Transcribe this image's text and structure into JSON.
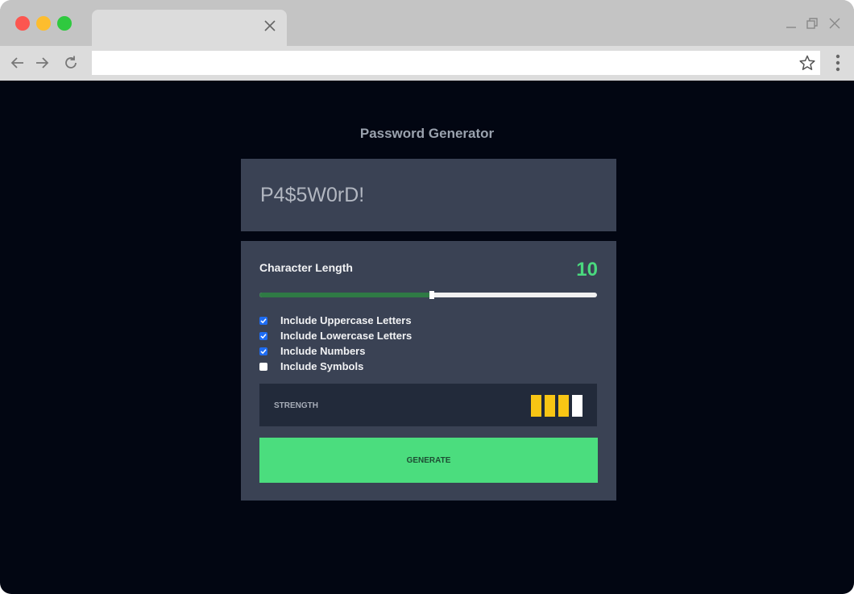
{
  "browser": {
    "tab_title": "",
    "address_value": ""
  },
  "page": {
    "title": "Password Generator",
    "result": "P4$5W0rD!",
    "length_label": "Character Length",
    "length_value": "10",
    "length_fraction": 0.51,
    "options": [
      {
        "label": "Include Uppercase Letters",
        "checked": true
      },
      {
        "label": "Include Lowercase Letters",
        "checked": true
      },
      {
        "label": "Include Numbers",
        "checked": true
      },
      {
        "label": "Include Symbols",
        "checked": false
      }
    ],
    "strength_label": "STRENGTH",
    "strength_level": 3,
    "strength_max": 4,
    "generate_label": "GENERATE"
  },
  "colors": {
    "accent": "#4bdd7e",
    "strength": "#f8c514",
    "panel": "#3a4254",
    "background": "#020612"
  },
  "icons": [
    "close-icon",
    "minimize-icon",
    "restore-icon",
    "back-arrow-icon",
    "forward-arrow-icon",
    "reload-icon",
    "star-icon",
    "kebab-menu-icon",
    "check-icon"
  ]
}
